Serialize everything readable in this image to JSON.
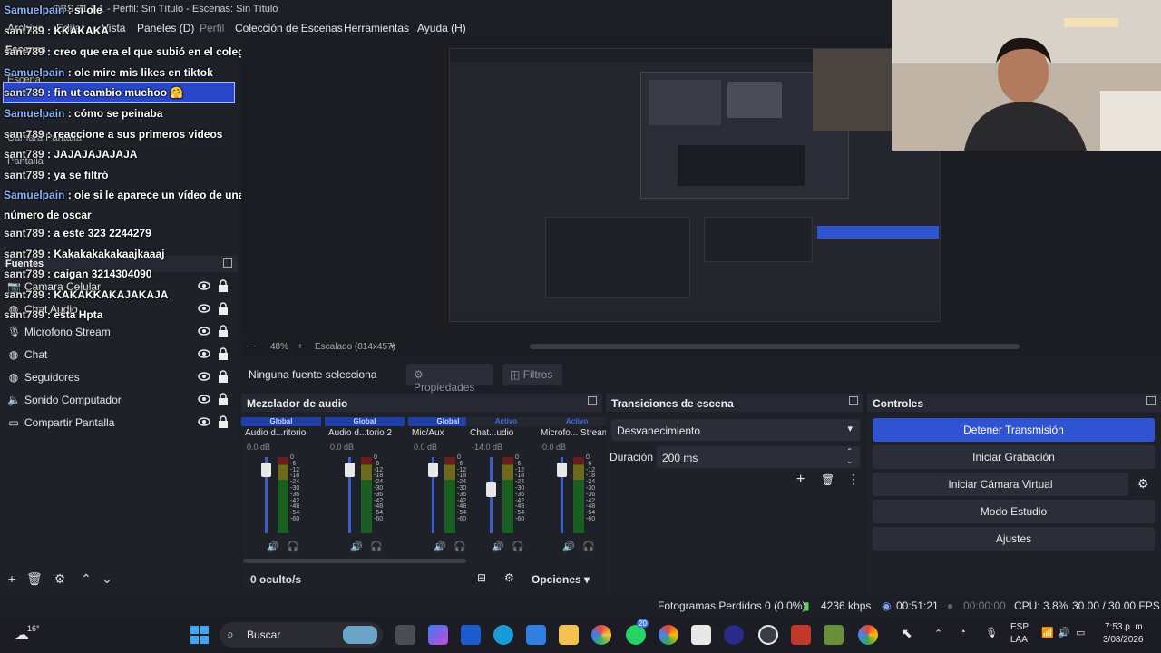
{
  "window": {
    "title": "OBS 31.1.1 - Perfil: Sin Título - Escenas: Sin Título"
  },
  "menu": {
    "items": [
      "Archivo",
      "Editar",
      "Vista",
      "Paneles (D)",
      "Perfil",
      "Colección de Escenas",
      "Herramientas",
      "Ayuda (H)"
    ]
  },
  "left_dock": {
    "scenes_title": "Escenas",
    "sources_title": "Fuentes",
    "scenes": [
      "Escena",
      "Camara Pantalla",
      "Pantalla"
    ],
    "sources": [
      {
        "label": "Camara Celular",
        "icon": "camera-icon"
      },
      {
        "label": "Chat Audio",
        "icon": "globe-icon"
      },
      {
        "label": "Microfono Stream",
        "icon": "microphone-icon"
      },
      {
        "label": "Chat",
        "icon": "globe-icon"
      },
      {
        "label": "Seguidores",
        "icon": "globe-icon"
      },
      {
        "label": "Sonido Computador",
        "icon": "speaker-icon"
      },
      {
        "label": "Compartir Pantalla",
        "icon": "monitor-icon"
      }
    ]
  },
  "chat": {
    "lines": [
      {
        "user": "Samuelpain",
        "text": ": si ole"
      },
      {
        "user": "sant789",
        "text": ": KKAKAKA"
      },
      {
        "user": "sant789",
        "text": ": creo que era el que subió en el colegio con sus amigos"
      },
      {
        "user": "Samuelpain",
        "text": ": ole mire mis likes en tiktok"
      },
      {
        "user": "sant789",
        "text": ": fin ut cambio muchoo 🤗"
      },
      {
        "user": "Samuelpain",
        "text": ": cómo se peinaba"
      },
      {
        "user": "sant789",
        "text": ": reaccione a sus primeros videos"
      },
      {
        "user": "sant789",
        "text": ": JAJAJAJAJAJA"
      },
      {
        "user": "sant789",
        "text": ": ya se filtró"
      },
      {
        "user": "Samuelpain",
        "text": ": ole si le aparece un vídeo de una pelada moviendo el culo filtra en"
      },
      {
        "user": "",
        "text": "número de oscar"
      },
      {
        "user": "sant789",
        "text": ": a este 323 2244279"
      },
      {
        "user": "sant789",
        "text": ": Kakakakakakaajkaaaj"
      },
      {
        "user": "sant789",
        "text": ": caigan 3214304090"
      },
      {
        "user": "sant789",
        "text": ": KAKAKKAKAJAKAJA"
      },
      {
        "user": "sant789",
        "text": ": esta Hpta"
      }
    ]
  },
  "preview": {
    "zoom": "48%",
    "scaling": "Escalado (814x457)"
  },
  "properties_bar": {
    "no_source": "Ninguna fuente selecciona",
    "properties": "Propiedades",
    "filters": "Filtros"
  },
  "mixer": {
    "title": "Mezclador de audio",
    "hidden": "0 oculto/s",
    "options": "Opciones",
    "channels": [
      {
        "tag": "Global",
        "name": "Audio d...ritorio",
        "db": "0.0 dB",
        "active": false
      },
      {
        "tag": "Global",
        "name": "Audio d...torio 2",
        "db": "0.0 dB",
        "active": false
      },
      {
        "tag": "Global",
        "name": "Mic/Aux",
        "db": "0.0 dB",
        "active": false
      },
      {
        "tag": "Activo",
        "name": "Chat...udio",
        "db": "-14.0 dB",
        "active": true
      },
      {
        "tag": "Activo",
        "name": "Microfo... Stream",
        "db": "0.0 dB",
        "active": true
      }
    ],
    "scale": [
      "0",
      "-6",
      "-12",
      "-18",
      "-24",
      "-30",
      "-36",
      "-42",
      "-48",
      "-54",
      "-60"
    ]
  },
  "transitions": {
    "title": "Transiciones de escena",
    "selected": "Desvanecimiento",
    "duration_label": "Duración",
    "duration_value": "200 ms"
  },
  "controls": {
    "title": "Controles",
    "stop_stream": "Detener Transmisión",
    "start_recording": "Iniciar Grabación",
    "virtual_cam": "Iniciar Cámara Virtual",
    "studio_mode": "Modo Estudio",
    "settings": "Ajustes"
  },
  "status": {
    "dropped": "Fotogramas Perdidos 0 (0.0%)",
    "bitrate": "4236 kbps",
    "stream_time": "00:51:21",
    "rec_time": "00:00:00",
    "cpu": "CPU: 3.8%",
    "fps": "30.00 / 30.00 FPS"
  },
  "taskbar": {
    "weather": "16°",
    "search": "Buscar",
    "lang": "ESP",
    "lang2": "LAA",
    "time": "7:53 p. m.",
    "date": "3/08/2026",
    "badge": "20"
  }
}
